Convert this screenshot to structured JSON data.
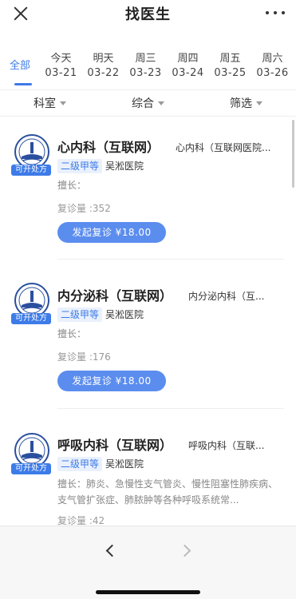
{
  "header": {
    "title": "找医生"
  },
  "date_tabs": {
    "all_label": "全部",
    "days": [
      {
        "weekday": "今天",
        "date": "03-21"
      },
      {
        "weekday": "明天",
        "date": "03-22"
      },
      {
        "weekday": "周三",
        "date": "03-23"
      },
      {
        "weekday": "周四",
        "date": "03-24"
      },
      {
        "weekday": "周五",
        "date": "03-25"
      },
      {
        "weekday": "周六",
        "date": "03-26"
      }
    ]
  },
  "filters": {
    "department": "科室",
    "sort": "综合",
    "filter": "筛选"
  },
  "departments": [
    {
      "name": "心内科（互联网）",
      "subtitle": "心内科（互联网医院...",
      "badge": "可开处方",
      "level": "二级甲等",
      "hospital": "吴淞医院",
      "specialty": "擅长：",
      "count": "复诊量 :352",
      "button": "发起复诊  ¥18.00"
    },
    {
      "name": "内分泌科（互联网）",
      "subtitle": "内分泌内科（互...",
      "badge": "可开处方",
      "level": "二级甲等",
      "hospital": "吴淞医院",
      "specialty": "擅长：",
      "count": "复诊量 :176",
      "button": "发起复诊  ¥18.00"
    },
    {
      "name": "呼吸内科（互联网）",
      "subtitle": "呼吸内科（互联...",
      "badge": "可开处方",
      "level": "二级甲等",
      "hospital": "吴淞医院",
      "specialty": "擅长：肺炎、急慢性支气管炎、慢性阻塞性肺疾病、支气管扩张症、肺脓肿等各种呼吸系统常...",
      "count": "复诊量 :42"
    }
  ],
  "colors": {
    "accent": "#3d7be8",
    "button": "#5b8def",
    "level_bg": "#eaf1fd"
  }
}
